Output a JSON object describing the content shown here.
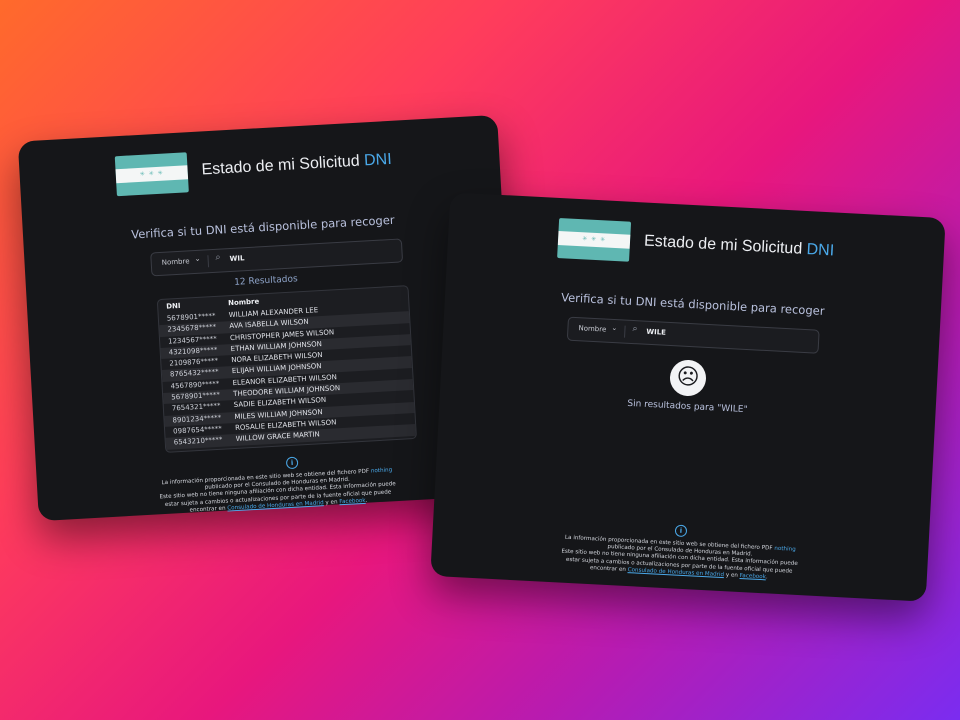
{
  "left": {
    "title_main": "Estado de mi Solicitud ",
    "title_accent": "DNI",
    "flag_stars": "✳ ✳ ✳",
    "subtitle": "Verifica si tu DNI está disponible para recoger",
    "search": {
      "filter_label": "Nombre",
      "value": "WIL"
    },
    "results_count": "12 Resultados",
    "table": {
      "headers": [
        "DNI",
        "Nombre"
      ],
      "rows": [
        {
          "dni": "5678901*****",
          "name": "WILLIAM ALEXANDER LEE"
        },
        {
          "dni": "2345678*****",
          "name": "AVA ISABELLA WILSON"
        },
        {
          "dni": "1234567*****",
          "name": "CHRISTOPHER JAMES WILSON"
        },
        {
          "dni": "4321098*****",
          "name": "ETHAN WILLIAM JOHNSON"
        },
        {
          "dni": "2109876*****",
          "name": "NORA ELIZABETH WILSON"
        },
        {
          "dni": "8765432*****",
          "name": "ELIJAH WILLIAM JOHNSON"
        },
        {
          "dni": "4567890*****",
          "name": "ELEANOR ELIZABETH WILSON"
        },
        {
          "dni": "5678901*****",
          "name": "THEODORE WILLIAM JOHNSON"
        },
        {
          "dni": "7654321*****",
          "name": "SADIE ELIZABETH WILSON"
        },
        {
          "dni": "8901234*****",
          "name": "MILES WILLIAM JOHNSON"
        },
        {
          "dni": "0987654*****",
          "name": "ROSALIE ELIZABETH WILSON"
        },
        {
          "dni": "6543210*****",
          "name": "WILLOW GRACE MARTIN"
        }
      ]
    },
    "info_glyph": "i",
    "footer": {
      "line1": "La información proporcionada en este sitio web se obtiene del fichero PDF ",
      "line1_link": "nothing",
      "line2": "publicado por el Consulado de Honduras en Madrid.",
      "line3": "Este sitio web no tiene ninguna afiliación con dicha entidad. Esta información puede",
      "line4": "estar sujeta a cambios o actualizaciones por parte de la fuente oficial que puede",
      "line5_pre": "encontrar en ",
      "line5_link1": "Consulado de Honduras en Madrid",
      "line5_mid": " y en ",
      "line5_link2": "Facebook",
      "line5_end": "."
    }
  },
  "right": {
    "title_main": "Estado de mi Solicitud ",
    "title_accent": "DNI",
    "flag_stars": "✳ ✳ ✳",
    "subtitle": "Verifica si tu DNI está disponible para recoger",
    "search": {
      "filter_label": "Nombre",
      "value": "WILE"
    },
    "sad_face": "☹",
    "no_results": "Sin resultados para \"WILE\"",
    "info_glyph": "i",
    "footer": {
      "line1": "La información proporcionada en este sitio web se obtiene del fichero PDF ",
      "line1_link": "nothing",
      "line2": "publicado por el Consulado de Honduras en Madrid.",
      "line3": "Este sitio web no tiene ninguna afiliación con dicha entidad. Esta información puede",
      "line4": "estar sujeta a cambios o actualizaciones por parte de la fuente oficial que puede",
      "line5_pre": "encontrar en ",
      "line5_link1": "Consulado de Honduras en Madrid",
      "line5_mid": " y en ",
      "line5_link2": "Facebook",
      "line5_end": "."
    }
  },
  "colors": {
    "accent": "#4aa8e8",
    "card_bg": "#151619",
    "flag_teal": "#5fb7b2"
  }
}
